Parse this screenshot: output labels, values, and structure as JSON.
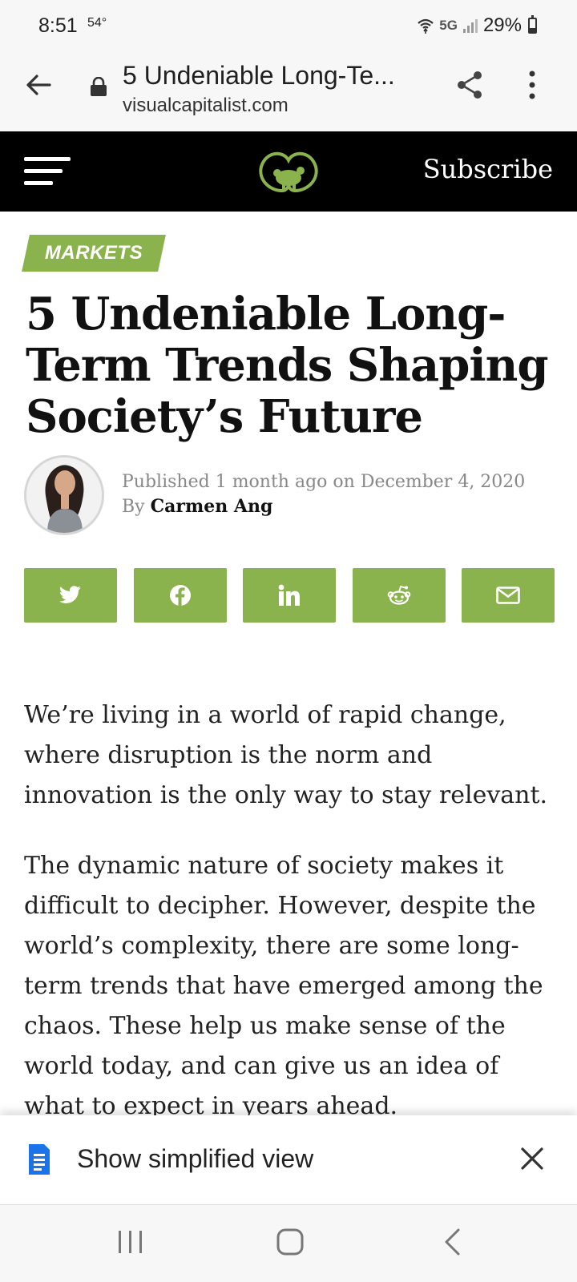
{
  "status_bar": {
    "time": "8:51",
    "temperature": "54°",
    "network": "5G",
    "battery": "29%"
  },
  "browser": {
    "page_title": "5 Undeniable Long-Te...",
    "domain": "visualcapitalist.com"
  },
  "site_header": {
    "subscribe_label": "Subscribe",
    "brand_color": "#8ab24d"
  },
  "article": {
    "category": "MARKETS",
    "title": "5 Undeniable Long-Term Trends Shaping Society’s Future",
    "published_prefix": "Published",
    "published_relative": "1 month ago",
    "published_on": "on",
    "published_date": "December 4, 2020",
    "by_label": "By",
    "author": "Carmen Ang",
    "share_buttons": [
      "twitter-icon",
      "facebook-icon",
      "linkedin-icon",
      "reddit-icon",
      "email-icon"
    ],
    "paragraphs": [
      "We’re living in a world of rapid change, where disruption is the norm and innovation is the only way to stay relevant.",
      "The dynamic nature of society makes it difficult to decipher. However, despite the world’s complexity, there are some long-term trends that have emerged among the chaos. These help us make sense of the world today, and can give us an idea of what to expect in years ahead."
    ]
  },
  "simplified_view": {
    "label": "Show simplified view"
  }
}
